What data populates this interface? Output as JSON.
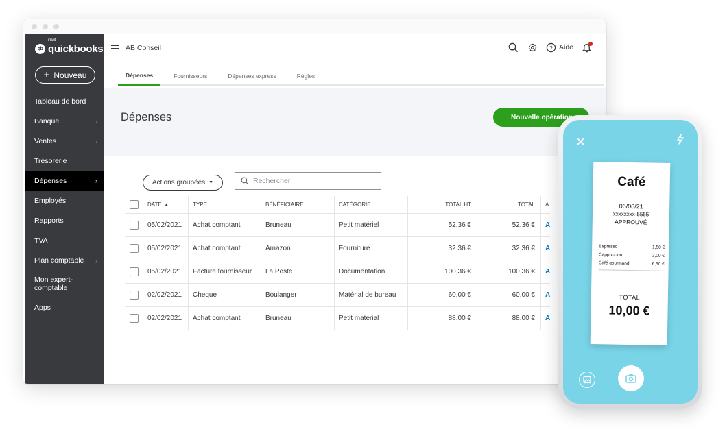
{
  "colors": {
    "sidebar": "#393a3d",
    "accent_green": "#2ca01c",
    "link_blue": "#0077c5",
    "phone_screen": "#79d4e8"
  },
  "logo": {
    "brand": "quickbooks",
    "prefix": "intuit",
    "mark": "qb"
  },
  "sidebar": {
    "new_button": "Nouveau",
    "items": [
      {
        "label": "Tableau de bord",
        "chevron": false
      },
      {
        "label": "Banque",
        "chevron": true
      },
      {
        "label": "Ventes",
        "chevron": true
      },
      {
        "label": "Trésorerie",
        "chevron": false
      },
      {
        "label": "Dépenses",
        "chevron": true,
        "active": true
      },
      {
        "label": "Employés",
        "chevron": false
      },
      {
        "label": "Rapports",
        "chevron": false
      },
      {
        "label": "TVA",
        "chevron": false
      },
      {
        "label": "Plan comptable",
        "chevron": true
      },
      {
        "label": "Mon expert-comptable",
        "chevron": false
      },
      {
        "label": "Apps",
        "chevron": false
      }
    ]
  },
  "header": {
    "company": "AB Conseil",
    "help_label": "Aide",
    "icons": [
      "search-icon",
      "gear-icon",
      "help-icon",
      "bell-icon"
    ],
    "tabs": [
      {
        "label": "Dépenses",
        "active": true
      },
      {
        "label": "Fournisseurs"
      },
      {
        "label": "Dépenses express"
      },
      {
        "label": "Règles"
      }
    ]
  },
  "page": {
    "title": "Dépenses",
    "new_operation": "Nouvelle opération",
    "batch_actions": "Actions groupées",
    "search_placeholder": "Rechercher"
  },
  "table": {
    "columns": {
      "date": "DATE",
      "type": "TYPE",
      "beneficiary": "BÉNÉFICIAIRE",
      "category": "CATÉGORIE",
      "total_ht": "TOTAL HT",
      "total": "TOTAL",
      "action": "A"
    },
    "rows": [
      {
        "date": "05/02/2021",
        "type": "Achat comptant",
        "beneficiary": "Bruneau",
        "category": "Petit matériel",
        "total_ht": "52,36 €",
        "total": "52,36 €",
        "action": "A"
      },
      {
        "date": "05/02/2021",
        "type": "Achat comptant",
        "beneficiary": "Amazon",
        "category": "Fourniture",
        "total_ht": "32,36 €",
        "total": "32,36 €",
        "action": "A"
      },
      {
        "date": "05/02/2021",
        "type": "Facture fournisseur",
        "beneficiary": "La Poste",
        "category": "Documentation",
        "total_ht": "100,36 €",
        "total": "100,36 €",
        "action": "A"
      },
      {
        "date": "02/02/2021",
        "type": "Cheque",
        "beneficiary": "Boulanger",
        "category": "Matérial de bureau",
        "total_ht": "60,00 €",
        "total": "60,00 €",
        "action": "A"
      },
      {
        "date": "02/02/2021",
        "type": "Achat comptant",
        "beneficiary": "Bruneau",
        "category": "Petit material",
        "total_ht": "88,00 €",
        "total": "88,00 €",
        "action": "A"
      }
    ]
  },
  "receipt": {
    "title": "Café",
    "date": "06/06/21",
    "card": "xxxxxxxx-5555",
    "status": "APPROUVÉ",
    "items": [
      {
        "name": "Espresso",
        "price": "1,50 €"
      },
      {
        "name": "Cappuccino",
        "price": "2,00 €"
      },
      {
        "name": "Café gourmand",
        "price": "6,50 €"
      }
    ],
    "total_label": "TOTAL",
    "total": "10,00 €"
  }
}
